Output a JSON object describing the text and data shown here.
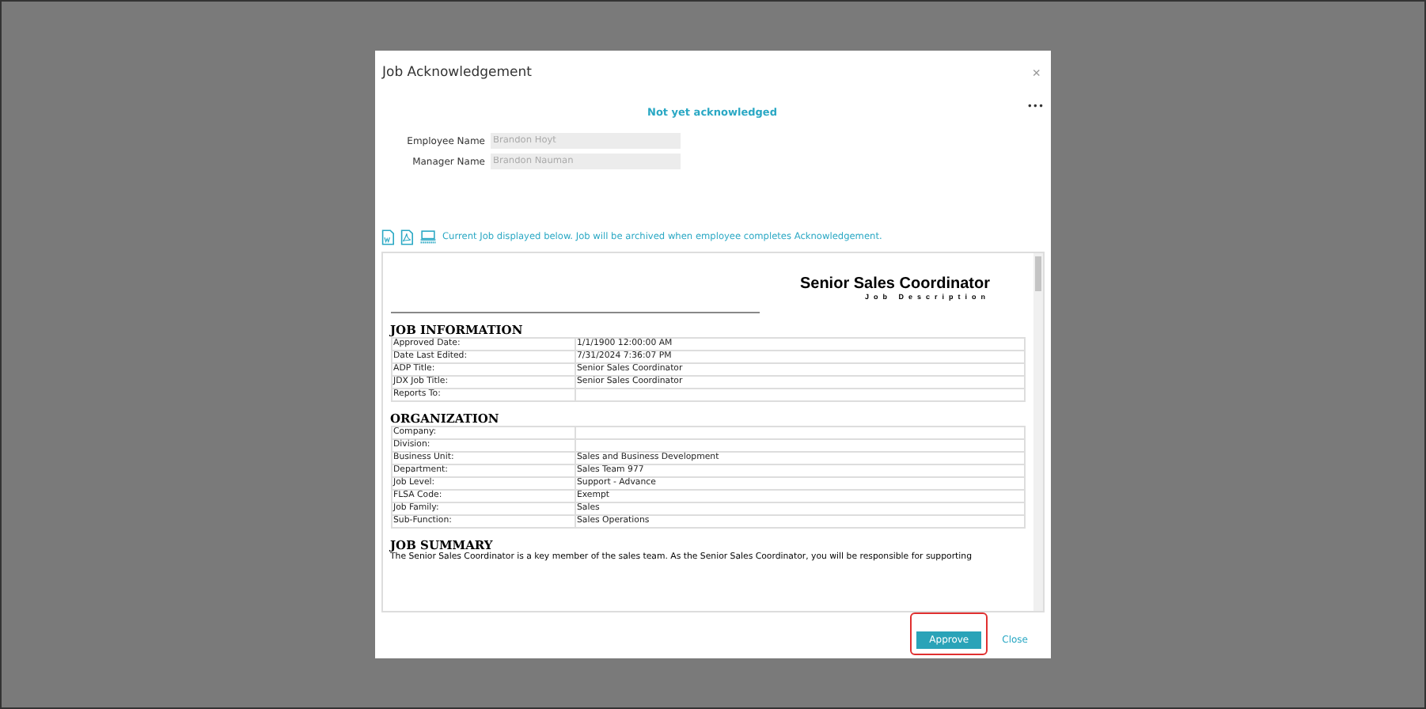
{
  "dialog": {
    "title": "Job Acknowledgement",
    "close": "×",
    "status": "Not yet acknowledged",
    "more": "•••"
  },
  "fields": [
    {
      "label": "Employee Name",
      "value": "Brandon Hoyt"
    },
    {
      "label": "Manager Name",
      "value": "Brandon Nauman"
    }
  ],
  "notice": "Current Job displayed below. Job will be archived when employee completes Acknowledgement.",
  "document": {
    "title": "Senior Sales Coordinator",
    "subtitle": "Job Description",
    "sections": [
      {
        "heading": "JOB INFORMATION",
        "rows": [
          [
            "Approved Date:",
            "1/1/1900 12:00:00 AM"
          ],
          [
            "Date Last Edited:",
            "7/31/2024 7:36:07 PM"
          ],
          [
            "ADP Title:",
            "Senior Sales Coordinator"
          ],
          [
            "JDX Job Title:",
            "Senior Sales Coordinator"
          ],
          [
            "Reports To:",
            ""
          ]
        ]
      },
      {
        "heading": "ORGANIZATION",
        "rows": [
          [
            "Company:",
            ""
          ],
          [
            "Division:",
            ""
          ],
          [
            "Business Unit:",
            "Sales and Business Development"
          ],
          [
            "Department:",
            "Sales Team  977"
          ],
          [
            "Job Level:",
            "Support - Advance"
          ],
          [
            "FLSA Code:",
            "Exempt"
          ],
          [
            "Job Family:",
            "Sales"
          ],
          [
            "Sub-Function:",
            "Sales Operations"
          ]
        ]
      },
      {
        "heading": "JOB SUMMARY",
        "text": "The Senior Sales Coordinator is a key member of the sales team. As the Senior Sales Coordinator, you will be responsible for supporting"
      }
    ]
  },
  "buttons": [
    {
      "label": "Approve",
      "kind": "primary",
      "highlighted": true
    },
    {
      "label": "Close",
      "kind": "link",
      "highlighted": false
    }
  ]
}
